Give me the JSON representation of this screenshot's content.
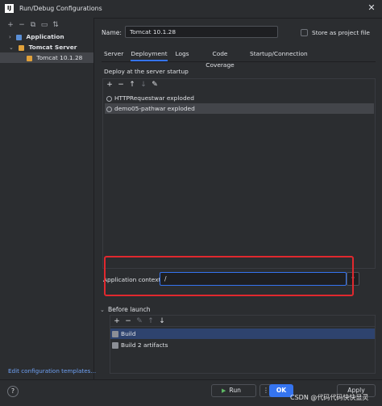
{
  "window": {
    "title": "Run/Debug Configurations",
    "app_icon_letter": "IJ"
  },
  "left_toolbar": [
    "add-icon",
    "remove-icon",
    "copy-icon",
    "folder-icon",
    "sort-icon"
  ],
  "tree": [
    {
      "label": "Application",
      "expanded": false,
      "bold": true
    },
    {
      "label": "Tomcat Server",
      "expanded": true,
      "bold": true
    },
    {
      "label": "Tomcat 10.1.28",
      "selected": true
    }
  ],
  "edit_templates_link": "Edit configuration templates...",
  "name_label": "Name:",
  "name_value": "Tomcat 10.1.28",
  "store_label": "Store as project file",
  "tabs": [
    "Server",
    "Deployment",
    "Logs",
    "Code Coverage",
    "Startup/Connection"
  ],
  "active_tab": "Deployment",
  "deploy_label": "Deploy at the server startup",
  "artifacts": [
    {
      "label": "HTTPRequestwar exploded",
      "selected": false
    },
    {
      "label": "demo05-pathwar exploded",
      "selected": true
    }
  ],
  "app_context_label": "Application context:",
  "app_context_value": "/",
  "before_launch_label": "Before launch",
  "before_launch_items": [
    {
      "label": "Build",
      "selected": true
    },
    {
      "label": "Build 2 artifacts",
      "selected": false
    }
  ],
  "buttons": {
    "help": "?",
    "run": "Run",
    "more": "⋮",
    "ok": "OK",
    "apply": "Apply"
  },
  "watermark": "CSDN @代码代码快快显灵",
  "colors": {
    "accent": "#3574f0",
    "highlight": "#e0282e",
    "background": "#2b2d30"
  }
}
